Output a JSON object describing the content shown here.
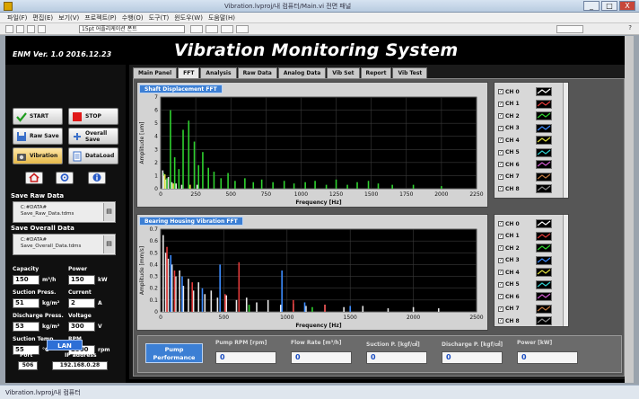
{
  "window": {
    "title": "Vibration.lvproj/내 컴퓨터/Main.vi 전면 패널",
    "menus": [
      "파일(F)",
      "편집(E)",
      "보기(V)",
      "프로젝트(P)",
      "수행(O)",
      "도구(T)",
      "윈도우(W)",
      "도움말(H)"
    ],
    "font_selector": "15pt 어플리케이션 폰트",
    "controls": {
      "minimize": "_",
      "maximize": "□",
      "close": "X"
    }
  },
  "header": {
    "version": "ENM Ver. 1.0 2016.12.23",
    "title": "Vibration Monitoring System"
  },
  "left_panel": {
    "buttons": {
      "start": "START",
      "stop": "STOP",
      "raw_save": "Raw Save",
      "overall_save": "Overall Save",
      "vibration": "Vibration",
      "dataload": "DataLoad"
    },
    "save_raw": {
      "label": "Save Raw Data",
      "path": "C:#DATA#\nSave_Raw_Data.tdms"
    },
    "save_overall": {
      "label": "Save Overall Data",
      "path": "C:#DATA#\nSave_Overall_Data.tdms"
    },
    "params": {
      "capacity": {
        "label": "Capacity",
        "value": "150",
        "unit": "m³/h"
      },
      "power": {
        "label": "Power",
        "value": "150",
        "unit": "kW"
      },
      "suction_press": {
        "label": "Suction Press.",
        "value": "51",
        "unit": "kg/m²"
      },
      "current": {
        "label": "Current",
        "value": "2",
        "unit": "A"
      },
      "discharge_press": {
        "label": "Discharge Press.",
        "value": "53",
        "unit": "kg/m²"
      },
      "voltage": {
        "label": "Voltage",
        "value": "300",
        "unit": "V"
      },
      "suction_temp": {
        "label": "Suction Temp",
        "value": "55",
        "unit": "°C"
      },
      "rpm": {
        "label": "RPM",
        "value": "2500",
        "unit": "rpm"
      }
    },
    "lan": {
      "button": "LAN",
      "port_label": "Port",
      "port_value": "506",
      "ip_label": "IP address",
      "ip_value": "192.168.0.28"
    }
  },
  "tabs": [
    {
      "label": "Main Panel",
      "active": false
    },
    {
      "label": "FFT",
      "active": true
    },
    {
      "label": "Analysis",
      "active": false
    },
    {
      "label": "Raw Data",
      "active": false
    },
    {
      "label": "Analog Data",
      "active": false
    },
    {
      "label": "Vib Set",
      "active": false
    },
    {
      "label": "Report",
      "active": false
    },
    {
      "label": "Vib Test",
      "active": false
    }
  ],
  "channels": [
    "CH 0",
    "CH 1",
    "CH 2",
    "CH 3",
    "CH 4",
    "CH 5",
    "CH 6",
    "CH 7",
    "CH 8"
  ],
  "channel_colors": [
    "#ffffff",
    "#e23a3a",
    "#2fd22f",
    "#3c8cff",
    "#e0e040",
    "#30d0d0",
    "#d05ad0",
    "#c07840",
    "#8c8c8c"
  ],
  "performance": {
    "button": "Pump Performance",
    "fields": [
      {
        "label": "Pump RPM [rpm]",
        "value": "0"
      },
      {
        "label": "Flow Rate [m³/h]",
        "value": "0"
      },
      {
        "label": "Suction P. [kgf/㎠]",
        "value": "0"
      },
      {
        "label": "Discharge P. [kgf/㎠]",
        "value": "0"
      },
      {
        "label": "Power [kW]",
        "value": "0"
      }
    ]
  },
  "status": {
    "left": "Vibration.lvproj/내 컴퓨터"
  },
  "chart_data": [
    {
      "type": "bar",
      "title": "Shaft Displacement FFT",
      "xlabel": "Frequency [Hz]",
      "ylabel": "Amplitude [um]",
      "xlim": [
        0,
        2250
      ],
      "ylim": [
        0,
        7
      ],
      "xticks": [
        0,
        250,
        500,
        750,
        1000,
        1250,
        1500,
        1750,
        2000,
        2250
      ],
      "yticks": [
        0,
        1,
        2,
        3,
        4,
        5,
        6,
        7
      ],
      "series": [
        {
          "color": "#2fd22f",
          "x": [
            20,
            45,
            70,
            100,
            130,
            160,
            200,
            240,
            270,
            300,
            340,
            380,
            430,
            480,
            530,
            600,
            660,
            720,
            800,
            880,
            950,
            1030,
            1100,
            1180,
            1250,
            1330,
            1400,
            1480,
            1550,
            1650,
            1800,
            2000
          ],
          "y": [
            1.2,
            0.8,
            6.0,
            2.4,
            1.5,
            4.5,
            5.2,
            3.6,
            1.8,
            2.8,
            1.6,
            1.3,
            0.8,
            1.2,
            0.6,
            0.8,
            0.5,
            0.7,
            0.5,
            0.6,
            0.4,
            0.5,
            0.6,
            0.3,
            0.7,
            0.3,
            0.5,
            0.6,
            0.4,
            0.3,
            0.3,
            0.2
          ]
        },
        {
          "color": "#e8e8e8",
          "x": [
            15,
            25,
            35,
            55,
            80,
            110,
            150,
            260
          ],
          "y": [
            1.4,
            1.0,
            0.7,
            0.9,
            0.5,
            0.4,
            0.3,
            0.3
          ]
        },
        {
          "color": "#e0e040",
          "x": [
            30,
            90,
            210
          ],
          "y": [
            1.1,
            0.4,
            0.3
          ]
        }
      ]
    },
    {
      "type": "bar",
      "title": "Bearing Housing Vibration FFT",
      "xlabel": "Frequency [Hz]",
      "ylabel": "Amplitude [mm/s]",
      "xlim": [
        0,
        2500
      ],
      "ylim": [
        0,
        0.7
      ],
      "xticks": [
        0,
        500,
        1000,
        1500,
        2000,
        2500
      ],
      "yticks": [
        0,
        0.1,
        0.2,
        0.3,
        0.4,
        0.5,
        0.6,
        0.7
      ],
      "series": [
        {
          "color": "#e8e8e8",
          "x": [
            20,
            40,
            60,
            90,
            120,
            150,
            180,
            220,
            260,
            300,
            350,
            400,
            450,
            520,
            600,
            680,
            760,
            850,
            950,
            1050,
            1150,
            1300,
            1450,
            1600,
            1800,
            2000,
            2200
          ],
          "y": [
            0.65,
            0.5,
            0.45,
            0.4,
            0.3,
            0.35,
            0.22,
            0.28,
            0.18,
            0.25,
            0.15,
            0.18,
            0.12,
            0.14,
            0.1,
            0.12,
            0.08,
            0.1,
            0.06,
            0.07,
            0.05,
            0.06,
            0.04,
            0.05,
            0.03,
            0.04,
            0.03
          ]
        },
        {
          "color": "#e23a3a",
          "x": [
            50,
            110,
            250,
            510,
            620,
            1050,
            1300
          ],
          "y": [
            0.55,
            0.35,
            0.25,
            0.15,
            0.42,
            0.1,
            0.06
          ]
        },
        {
          "color": "#3c8cff",
          "x": [
            80,
            170,
            330,
            470,
            960,
            1140,
            1500
          ],
          "y": [
            0.48,
            0.3,
            0.2,
            0.4,
            0.35,
            0.08,
            0.05
          ]
        },
        {
          "color": "#2fd22f",
          "x": [
            700,
            1200
          ],
          "y": [
            0.06,
            0.04
          ]
        }
      ]
    }
  ]
}
